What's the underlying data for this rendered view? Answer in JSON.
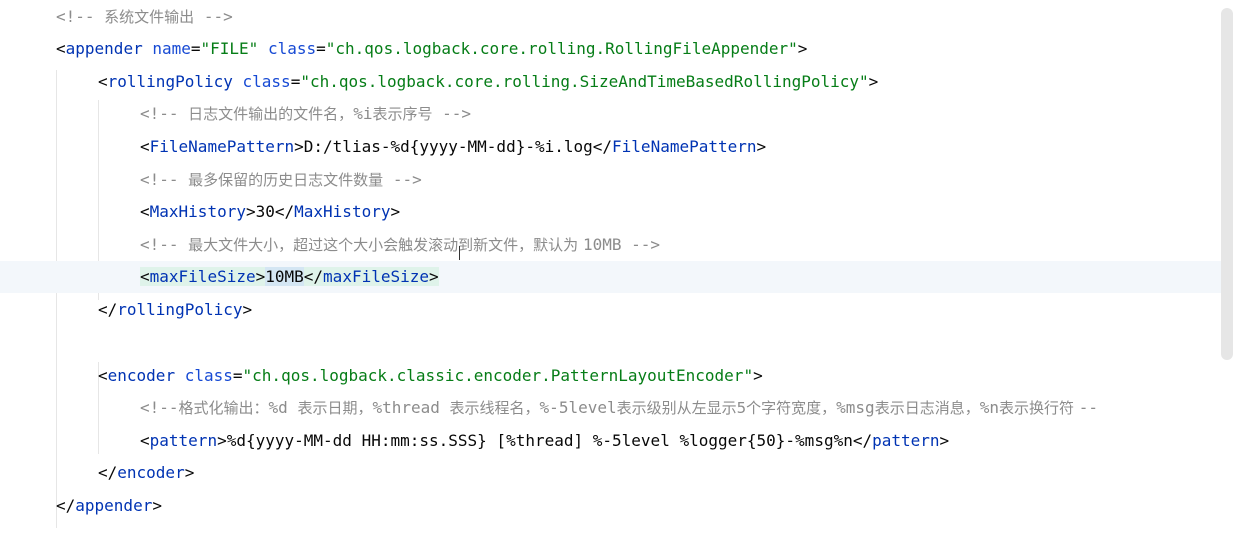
{
  "gutter": {
    "bulb_icon": "lightbulb-icon"
  },
  "lines": [
    {
      "parts": [
        [
          "cm",
          "<!-- "
        ],
        [
          "cmtxt",
          "系统文件输出"
        ],
        [
          "cm",
          " -->"
        ]
      ]
    },
    {
      "parts": [
        [
          "br",
          "<"
        ],
        [
          "tag",
          "appender"
        ],
        [
          "br",
          " "
        ],
        [
          "attr",
          "name"
        ],
        [
          "br",
          "="
        ],
        [
          "str",
          "\"FILE\""
        ],
        [
          "br",
          " "
        ],
        [
          "attr",
          "class"
        ],
        [
          "br",
          "="
        ],
        [
          "str",
          "\"ch.qos.logback.core.rolling.RollingFileAppender\""
        ],
        [
          "br",
          ">"
        ]
      ]
    },
    {
      "parts": [
        [
          "br",
          "<"
        ],
        [
          "tag",
          "rollingPolicy"
        ],
        [
          "br",
          " "
        ],
        [
          "attr",
          "class"
        ],
        [
          "br",
          "="
        ],
        [
          "str",
          "\"ch.qos.logback.core.rolling.SizeAndTimeBasedRollingPolicy\""
        ],
        [
          "br",
          ">"
        ]
      ]
    },
    {
      "parts": [
        [
          "cm",
          "<!-- "
        ],
        [
          "cmtxt",
          "日志文件输出的文件名，"
        ],
        [
          "cm",
          "%i"
        ],
        [
          "cmtxt",
          "表示序号"
        ],
        [
          "cm",
          " -->"
        ]
      ]
    },
    {
      "parts": [
        [
          "br",
          "<"
        ],
        [
          "tag",
          "FileNamePattern"
        ],
        [
          "br",
          ">D:/tlias-%d{yyyy-MM-dd}-%i.log</"
        ],
        [
          "tag",
          "FileNamePattern"
        ],
        [
          "br",
          ">"
        ]
      ]
    },
    {
      "parts": [
        [
          "cm",
          "<!-- "
        ],
        [
          "cmtxt",
          "最多保留的历史日志文件数量"
        ],
        [
          "cm",
          " -->"
        ]
      ]
    },
    {
      "parts": [
        [
          "br",
          "<"
        ],
        [
          "tag",
          "MaxHistory"
        ],
        [
          "br",
          ">30</"
        ],
        [
          "tag",
          "MaxHistory"
        ],
        [
          "br",
          ">"
        ]
      ]
    },
    {
      "parts": [
        [
          "cm",
          "<!-- "
        ],
        [
          "cmtxt",
          "最大文件大小，超过这个大小会触发滚动到新文件，默认为 "
        ],
        [
          "cm",
          "10MB -->"
        ]
      ]
    },
    {
      "parts": [
        [
          "br",
          "<"
        ],
        [
          "tag",
          "maxFileSize"
        ],
        [
          "br",
          ">"
        ],
        [
          "hl",
          "10MB"
        ],
        [
          "br",
          "</"
        ],
        [
          "tag",
          "maxFileSize"
        ],
        [
          "br",
          ">"
        ]
      ]
    },
    {
      "parts": [
        [
          "br",
          "</"
        ],
        [
          "tag",
          "rollingPolicy"
        ],
        [
          "br",
          ">"
        ]
      ]
    },
    {
      "parts": []
    },
    {
      "parts": [
        [
          "br",
          "<"
        ],
        [
          "tag",
          "encoder"
        ],
        [
          "br",
          " "
        ],
        [
          "attr",
          "class"
        ],
        [
          "br",
          "="
        ],
        [
          "str",
          "\"ch.qos.logback.classic.encoder.PatternLayoutEncoder\""
        ],
        [
          "br",
          ">"
        ]
      ]
    },
    {
      "parts": [
        [
          "cm",
          "<!--"
        ],
        [
          "cmtxt",
          "格式化输出："
        ],
        [
          "cm",
          "%d "
        ],
        [
          "cmtxt",
          "表示日期，"
        ],
        [
          "cm",
          "%thread "
        ],
        [
          "cmtxt",
          "表示线程名，"
        ],
        [
          "cm",
          "%-5level"
        ],
        [
          "cmtxt",
          "表示级别从左显示5个字符宽度，"
        ],
        [
          "cm",
          "%msg"
        ],
        [
          "cmtxt",
          "表示日志消息，"
        ],
        [
          "cm",
          "%n"
        ],
        [
          "cmtxt",
          "表示换行符 "
        ],
        [
          "cm",
          "--"
        ]
      ]
    },
    {
      "parts": [
        [
          "br",
          "<"
        ],
        [
          "tag",
          "pattern"
        ],
        [
          "br",
          ">%d{yyyy-MM-dd HH:mm:ss.SSS} [%thread] %-5level %logger{50}-%msg%n</"
        ],
        [
          "tag",
          "pattern"
        ],
        [
          "br",
          ">"
        ]
      ]
    },
    {
      "parts": [
        [
          "br",
          "</"
        ],
        [
          "tag",
          "encoder"
        ],
        [
          "br",
          ">"
        ]
      ]
    },
    {
      "parts": [
        [
          "br",
          "</"
        ],
        [
          "tag",
          "appender"
        ],
        [
          "br",
          ">"
        ]
      ]
    }
  ]
}
